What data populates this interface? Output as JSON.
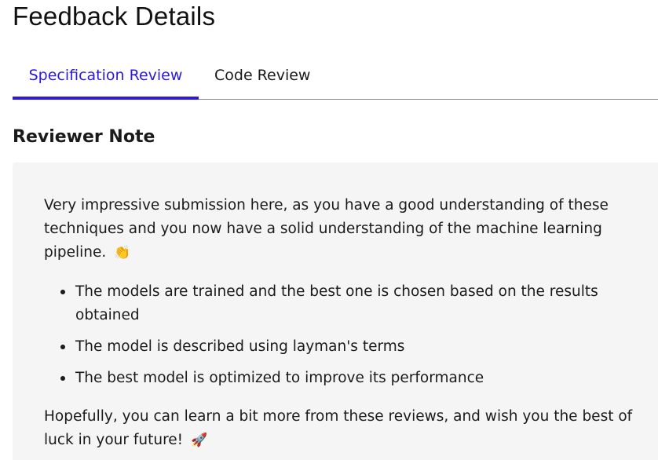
{
  "page": {
    "title": "Feedback Details"
  },
  "tabs": [
    {
      "label": "Specification Review",
      "active": true
    },
    {
      "label": "Code Review",
      "active": false
    }
  ],
  "reviewer_note": {
    "heading": "Reviewer Note",
    "intro": "Very impressive submission here, as you have a good understanding of these techniques and you now have a solid understanding of the machine learning pipeline.",
    "intro_emoji": "👏",
    "bullets": [
      "The models are trained and the best one is chosen based on the results obtained",
      "The model is described using layman's terms",
      "The best model is optimized to improve its performance"
    ],
    "outro": "Hopefully, you can learn a bit more from these reviews, and wish you the best of luck in your future!",
    "outro_emoji": "🚀"
  },
  "colors": {
    "accent": "#2b1ad8",
    "panel_background": "#f5f5f5",
    "text": "#1a1a1a"
  }
}
